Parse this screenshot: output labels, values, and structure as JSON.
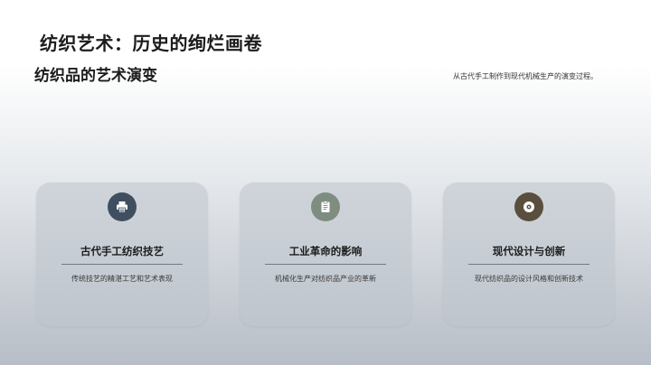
{
  "slide": {
    "title": "纺织艺术：历史的绚烂画卷",
    "subtitle": "纺织品的艺术演变",
    "description": "从古代手工制作到现代机械生产的演变过程。"
  },
  "cards": [
    {
      "icon": "printer-icon",
      "icon_color": "#3f4f60",
      "title": "古代手工纺织技艺",
      "text": "传统技艺的精湛工艺和艺术表现"
    },
    {
      "icon": "clipboard-icon",
      "icon_color": "#7f8c80",
      "title": "工业革命的影响",
      "text": "机械化生产对纺织品产业的革新"
    },
    {
      "icon": "disc-icon",
      "icon_color": "#5a4e3f",
      "title": "现代设计与创新",
      "text": "现代纺织品的设计风格和创新技术"
    }
  ]
}
